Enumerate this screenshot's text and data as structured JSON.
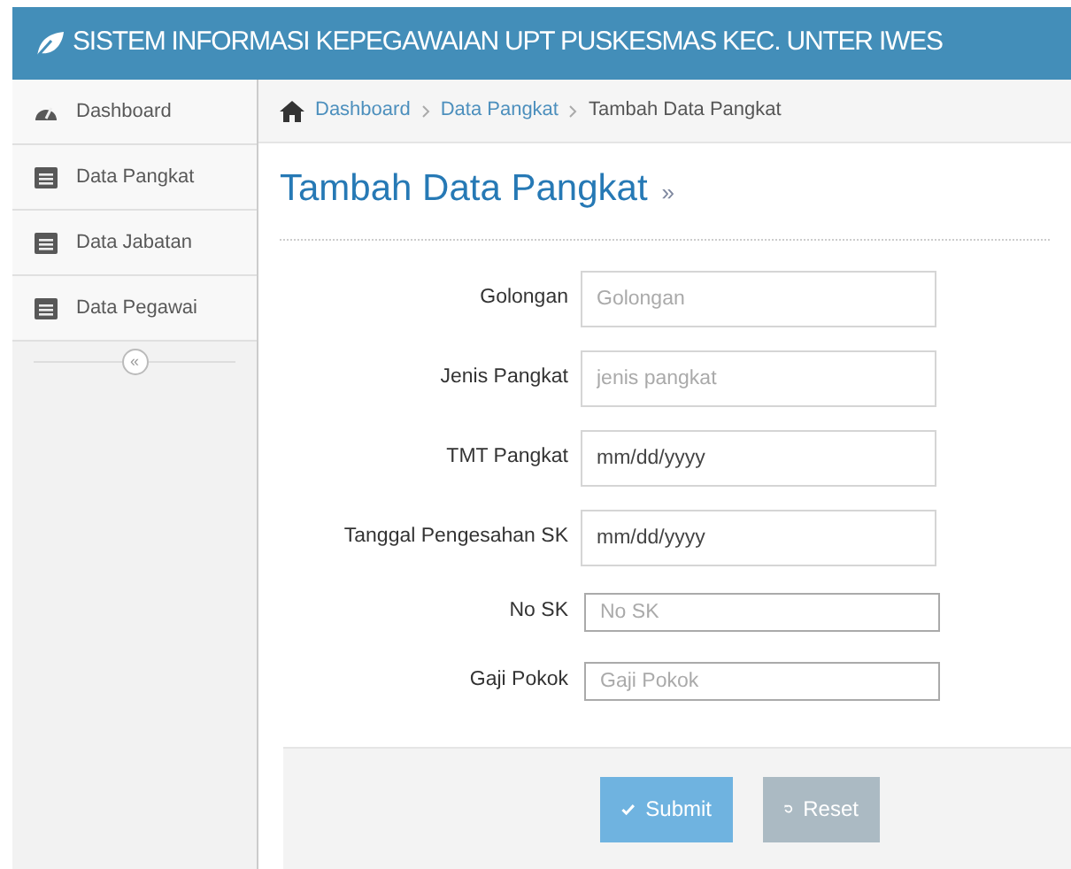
{
  "header": {
    "title": "SISTEM INFORMASI KEPEGAWAIAN UPT PUSKESMAS KEC. UNTER IWES"
  },
  "sidebar": {
    "items": [
      {
        "label": "Dashboard",
        "kind": "dashboard",
        "selected": false
      },
      {
        "label": "Data Pangkat",
        "kind": "list",
        "selected": false
      },
      {
        "label": "Data Jabatan",
        "kind": "list",
        "selected": false
      },
      {
        "label": "Data Pegawai",
        "kind": "list",
        "selected": false
      }
    ],
    "collapse": "«"
  },
  "breadcrumb": [
    "Dashboard",
    "Data Pangkat",
    "Tambah Data Pangkat"
  ],
  "page_title": "Tambah Data Pangkat",
  "title_suffix": "»",
  "form": {
    "fields": [
      {
        "label": "Golongan",
        "placeholder": "Golongan",
        "kind": "text"
      },
      {
        "label": "Jenis Pangkat",
        "placeholder": "jenis pangkat",
        "kind": "text"
      },
      {
        "label": "TMT Pangkat",
        "placeholder": "mm/dd/yyyy",
        "kind": "date"
      },
      {
        "label": "Tanggal Pengesahan SK",
        "placeholder": "mm/dd/yyyy",
        "kind": "date"
      },
      {
        "label": "No SK",
        "placeholder": "No SK",
        "kind": "small"
      },
      {
        "label": "Gaji Pokok",
        "placeholder": "Gaji Pokok",
        "kind": "small"
      }
    ],
    "buttons": [
      {
        "label": "Submit",
        "kind": "submit"
      },
      {
        "label": "Reset",
        "kind": "reset"
      }
    ]
  }
}
